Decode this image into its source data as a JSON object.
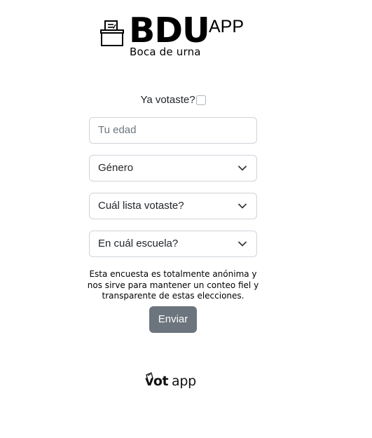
{
  "header": {
    "brand": "BDU",
    "brand_suffix": "APP",
    "tagline": "Boca de urna",
    "icon": "ballot-box-icon"
  },
  "form": {
    "voted_label": "Ya votaste?",
    "voted_checked": false,
    "age_placeholder": "Tu edad",
    "gender_label": "Género",
    "list_label": "Cuál lista votaste?",
    "school_label": "En cuál escuela?",
    "disclaimer": "Esta encuesta es totalmente anónima y nos sirve para mantener un conteo fiel y transparente de estas elecciones.",
    "submit_label": "Enviar"
  },
  "footer": {
    "logo_bold": "vot",
    "logo_light": "app",
    "icon": "votapp-ballot-icon"
  },
  "colors": {
    "brand": "#000000",
    "button": "#6c757d",
    "border": "#ced4da",
    "placeholder": "#6c757d"
  }
}
